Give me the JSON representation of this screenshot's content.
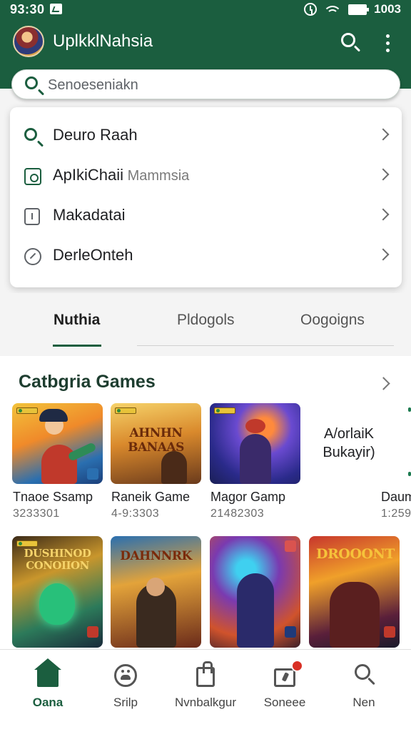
{
  "status": {
    "time": "93:30",
    "battery": "1003"
  },
  "header": {
    "title": "UplkklNahsia"
  },
  "search": {
    "placeholder": "Senoeseniakn"
  },
  "dropdown": {
    "items": [
      {
        "label": "Deuro Raah",
        "label_muted": "",
        "icon": "search-icon"
      },
      {
        "label": "ApIkiChaii",
        "label_muted": " Mammsia",
        "icon": "app-icon"
      },
      {
        "label": "Makadatai",
        "label_muted": "",
        "icon": "key-icon"
      },
      {
        "label": "DerleOnteh",
        "label_muted": "",
        "icon": "compass-icon"
      }
    ]
  },
  "tabs": [
    "Nuthia",
    "Pldogols",
    "Oogoigns"
  ],
  "section": {
    "title": "Catbgria Games"
  },
  "games_row1": [
    {
      "name": "Tnaoe Ssamp",
      "meta": "3233301",
      "art_text": ""
    },
    {
      "name": "Raneik Game",
      "meta": "4-9:3303",
      "art_text": "AHNHN BANAAS"
    },
    {
      "name": "Magor Gamp",
      "meta": "21482303",
      "art_text": ""
    },
    {
      "name": "Daum",
      "meta": "1:259",
      "art_text": ""
    }
  ],
  "promo": {
    "line1": "A/orlaiK",
    "line2": "Bukayir)"
  },
  "games_row2": [
    {
      "art_text": "DUSHINOD CONOIION"
    },
    {
      "art_text": "DAHNNRK"
    },
    {
      "art_text": ""
    },
    {
      "art_text": "DROOONT"
    }
  ],
  "bottom_nav": [
    {
      "label": "Oana",
      "icon": "home-icon",
      "active": true
    },
    {
      "label": "Srilp",
      "icon": "gamepad-icon",
      "active": false
    },
    {
      "label": "Nvnbalkgur",
      "icon": "bag-icon",
      "active": false
    },
    {
      "label": "Soneee",
      "icon": "apps-icon",
      "active": false
    },
    {
      "label": "Nen",
      "icon": "search-icon",
      "active": false
    }
  ],
  "colors": {
    "brand": "#1b5e3f",
    "notification": "#d93025"
  }
}
